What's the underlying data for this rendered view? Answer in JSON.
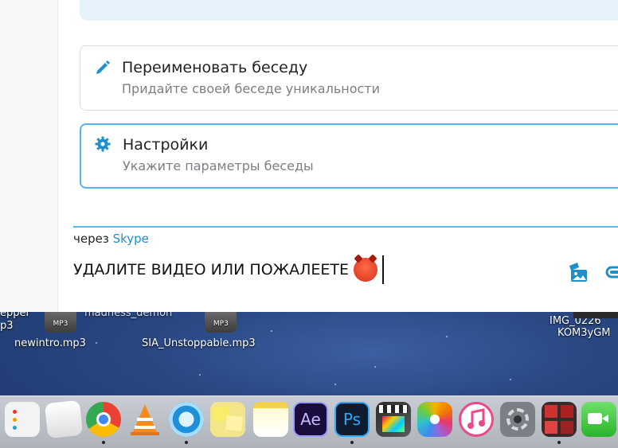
{
  "desktop": {
    "files": [
      {
        "name": "newintro.mp3",
        "badge": "MP3"
      },
      {
        "name": "SIA_Unstoppable.mp3",
        "badge": "MP3"
      }
    ],
    "partial_labels": {
      "left_top": "epper",
      "left_bottom": "p3",
      "middle_top": "madness_demon",
      "right_top": "IMG_0226",
      "right_bottom": "KOM3yGM"
    }
  },
  "options": [
    {
      "title": "Переименовать беседу",
      "subtitle": "Придайте своей беседе уникальности",
      "icon": "pencil-icon"
    },
    {
      "title": "Настройки",
      "subtitle": "Укажите параметры беседы",
      "icon": "gear-icon"
    }
  ],
  "composer": {
    "via_prefix": "через",
    "via_app": "Skype",
    "message": "УДАЛИТЕ ВИДЕО ИЛИ ПОЖАЛЕЕТЕ"
  },
  "colors": {
    "accent": "#50b5e8",
    "link": "#1e8fc8"
  },
  "dock": {
    "apps": [
      "reminders-icon",
      "textedit-icon",
      "chrome-icon",
      "vlc-icon",
      "quicktime-icon",
      "stickies-icon",
      "notes-icon",
      "after-effects-icon",
      "photoshop-icon",
      "final-cut-icon",
      "photos-icon",
      "itunes-icon",
      "system-preferences-icon",
      "photo-booth-icon",
      "facetime-icon"
    ],
    "ae_label": "Ae",
    "ps_label": "Ps"
  }
}
